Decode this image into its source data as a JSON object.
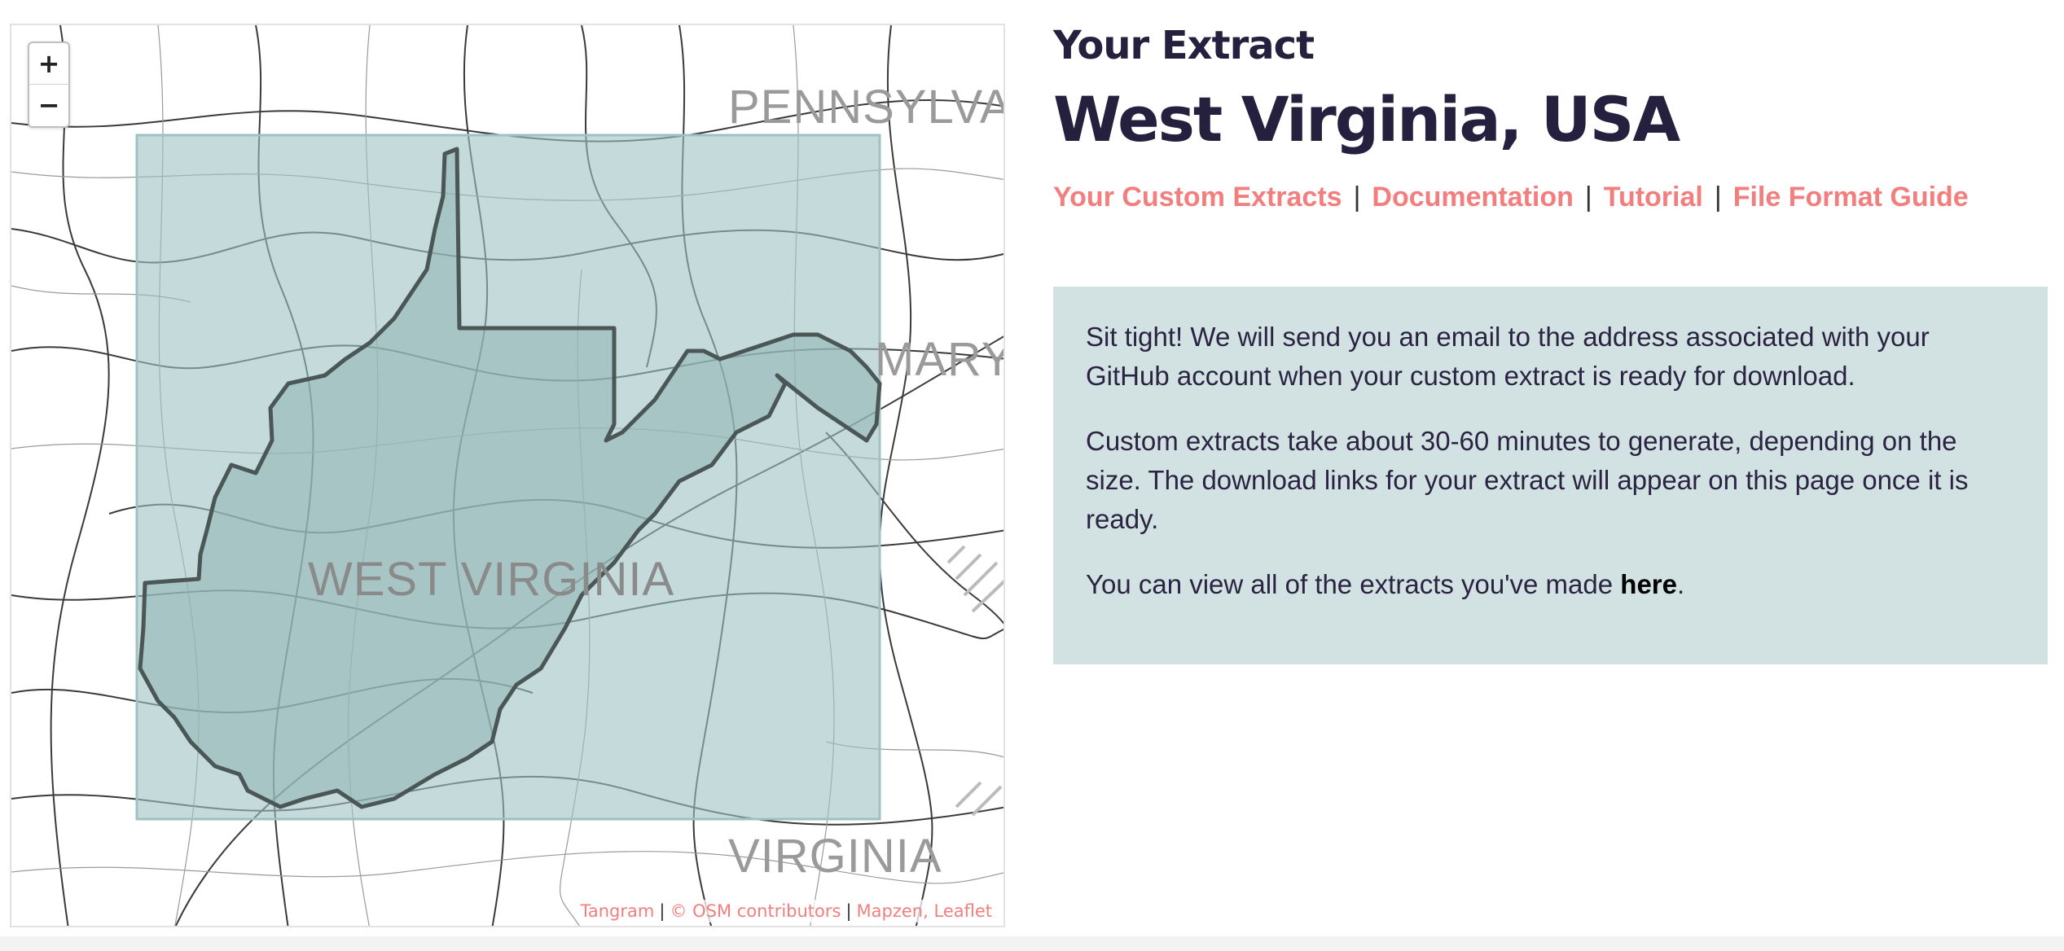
{
  "map": {
    "labels": {
      "pennsylvania": "PENNSYLVAN",
      "maryland": "MARYL",
      "west_virginia": "WEST VIRGINIA",
      "virginia": "VIRGINIA"
    },
    "zoom_in": "+",
    "zoom_out": "−",
    "attribution": {
      "tangram": "Tangram",
      "osm": "© OSM contributors",
      "mapzen": "Mapzen",
      "leaflet": "Leaflet",
      "sep": "|"
    },
    "colors": {
      "extract_fill": "#9fc1c1",
      "state_fill": "#8fb5b5",
      "border": "#4b5656"
    }
  },
  "header": {
    "eyebrow": "Your Extract",
    "title": "West Virginia, USA"
  },
  "nav": {
    "custom_extracts": "Your Custom Extracts",
    "documentation": "Documentation",
    "tutorial": "Tutorial",
    "file_format_guide": "File Format Guide",
    "separator": "|"
  },
  "notice": {
    "paragraph1": "Sit tight! We will send you an email to the address associated with your GitHub account when your custom extract is ready for download.",
    "paragraph2": "Custom extracts take about 30-60 minutes to generate, depending on the size. The download links for your extract will appear on this page once it is ready.",
    "paragraph3_prefix": "You can view all of the extracts you've made ",
    "paragraph3_link": "here",
    "paragraph3_suffix": "."
  },
  "colors": {
    "accent": "#f27e7e",
    "heading": "#26203f",
    "notice_bg": "#d2e2e2"
  }
}
